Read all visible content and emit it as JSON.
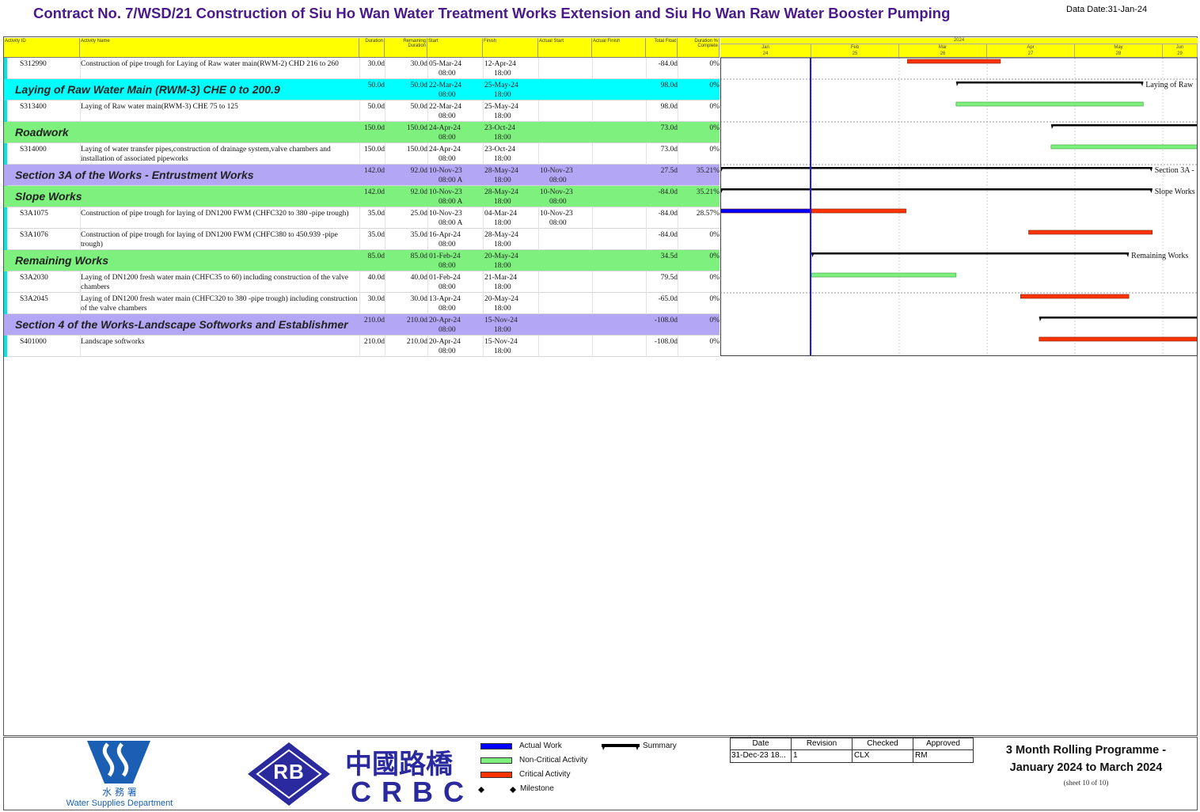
{
  "title": "Contract No. 7/WSD/21 Construction of Siu Ho Wan Water Treatment Works Extension and Siu Ho Wan Raw Water Booster Pumping",
  "data_date": "Data Date:31-Jan-24",
  "columns": {
    "activity_id": "Activity ID",
    "activity_name": "Activity Name",
    "duration": "Duration",
    "remaining_duration": "Remaining Duration",
    "start": "Start",
    "finish": "Finish",
    "actual_start": "Actual Start",
    "actual_finish": "Actual Finish",
    "total_float": "Total Float",
    "duration_pct": "Duration % Complete"
  },
  "timescale": {
    "year": "2024",
    "months": [
      "Jan",
      "Feb",
      "Mar",
      "Apr",
      "May",
      "Jun"
    ],
    "days": [
      "24",
      "25",
      "26",
      "27",
      "28",
      "29"
    ]
  },
  "rows": [
    {
      "type": "activity",
      "id": "S312990",
      "name": "Construction of pipe trough for Laying of Raw water main(RWM-2) CHD 216 to 260",
      "dur": "30.0d",
      "rem": "30.0d",
      "start": "05-Mar-24",
      "start_t": "08:00",
      "finish": "12-Apr-24",
      "finish_t": "18:00",
      "astart": "",
      "astart_t": "",
      "tf": "-84.0d",
      "pct": "0%"
    },
    {
      "type": "group",
      "color": "#00ffff",
      "name": "Laying of Raw Water Main (RWM-3) CHE 0  to 200.9",
      "dur": "50.0d",
      "rem": "50.0d",
      "start": "22-Mar-24",
      "start_t": "08:00",
      "finish": "25-May-24",
      "finish_t": "18:00",
      "astart": "",
      "astart_t": "",
      "tf": "98.0d",
      "pct": "0%",
      "label": "Laying of Raw"
    },
    {
      "type": "activity",
      "id": "S313400",
      "name": "Laying of Raw water main(RWM-3) CHE 75 to 125",
      "dur": "50.0d",
      "rem": "50.0d",
      "start": "22-Mar-24",
      "start_t": "08:00",
      "finish": "25-May-24",
      "finish_t": "18:00",
      "astart": "",
      "astart_t": "",
      "tf": "98.0d",
      "pct": "0%"
    },
    {
      "type": "group",
      "color": "#7df07d",
      "name": "Roadwork",
      "dur": "150.0d",
      "rem": "150.0d",
      "start": "24-Apr-24",
      "start_t": "08:00",
      "finish": "23-Oct-24",
      "finish_t": "18:00",
      "astart": "",
      "astart_t": "",
      "tf": "73.0d",
      "pct": "0%",
      "label": ""
    },
    {
      "type": "activity",
      "id": "S314000",
      "name": "Laying of water transfer pipes,construction of drainage system,valve chambers and installation of associated pipeworks",
      "dur": "150.0d",
      "rem": "150.0d",
      "start": "24-Apr-24",
      "start_t": "08:00",
      "finish": "23-Oct-24",
      "finish_t": "18:00",
      "astart": "",
      "astart_t": "",
      "tf": "73.0d",
      "pct": "0%"
    },
    {
      "type": "group",
      "color": "#b3a6f5",
      "name": "Section 3A of the Works - Entrustment Works",
      "dur": "142.0d",
      "rem": "92.0d",
      "start": "10-Nov-23",
      "start_t": "08:00 A",
      "finish": "28-May-24",
      "finish_t": "18:00",
      "astart": "10-Nov-23",
      "astart_t": "08:00",
      "tf": "27.5d",
      "pct": "35.21%",
      "label": "Section 3A -"
    },
    {
      "type": "group",
      "color": "#7df07d",
      "name": "Slope Works",
      "dur": "142.0d",
      "rem": "92.0d",
      "start": "10-Nov-23",
      "start_t": "08:00 A",
      "finish": "28-May-24",
      "finish_t": "18:00",
      "astart": "10-Nov-23",
      "astart_t": "08:00",
      "tf": "-84.0d",
      "pct": "35.21%",
      "label": "Slope Works"
    },
    {
      "type": "activity",
      "id": "S3A1075",
      "name": "Construction of pipe trough for laying of DN1200 FWM (CHFC320 to 380 -pipe trough)",
      "dur": "35.0d",
      "rem": "25.0d",
      "start": "10-Nov-23",
      "start_t": "08:00 A",
      "finish": "04-Mar-24",
      "finish_t": "18:00",
      "astart": "10-Nov-23",
      "astart_t": "08:00",
      "tf": "-84.0d",
      "pct": "28.57%"
    },
    {
      "type": "activity",
      "id": "S3A1076",
      "name": "Construction of pipe trough for laying of DN1200 FWM (CHFC380 to 450.939 -pipe trough)",
      "dur": "35.0d",
      "rem": "35.0d",
      "start": "16-Apr-24",
      "start_t": "08:00",
      "finish": "28-May-24",
      "finish_t": "18:00",
      "astart": "",
      "astart_t": "",
      "tf": "-84.0d",
      "pct": "0%"
    },
    {
      "type": "group",
      "color": "#7df07d",
      "name": "Remaining Works",
      "dur": "85.0d",
      "rem": "85.0d",
      "start": "01-Feb-24",
      "start_t": "08:00",
      "finish": "20-May-24",
      "finish_t": "18:00",
      "astart": "",
      "astart_t": "",
      "tf": "34.5d",
      "pct": "0%",
      "label": "Remaining Works"
    },
    {
      "type": "activity",
      "id": "S3A2030",
      "name": "Laying of DN1200 fresh water main (CHFC35 to 60) including construction of the valve chambers",
      "dur": "40.0d",
      "rem": "40.0d",
      "start": "01-Feb-24",
      "start_t": "08:00",
      "finish": "21-Mar-24",
      "finish_t": "18:00",
      "astart": "",
      "astart_t": "",
      "tf": "79.5d",
      "pct": "0%"
    },
    {
      "type": "activity",
      "id": "S3A2045",
      "name": "Laying of DN1200 fresh water main (CHFC320 to 380 -pipe trough) including construction of the valve chambers",
      "dur": "30.0d",
      "rem": "30.0d",
      "start": "13-Apr-24",
      "start_t": "08:00",
      "finish": "20-May-24",
      "finish_t": "18:00",
      "astart": "",
      "astart_t": "",
      "tf": "-65.0d",
      "pct": "0%"
    },
    {
      "type": "group",
      "color": "#b3a6f5",
      "name": "Section 4 of the Works-Landscape Softworks and Establishmer",
      "dur": "210.0d",
      "rem": "210.0d",
      "start": "20-Apr-24",
      "start_t": "08:00",
      "finish": "15-Nov-24",
      "finish_t": "18:00",
      "astart": "",
      "astart_t": "",
      "tf": "-108.0d",
      "pct": "0%",
      "label": ""
    },
    {
      "type": "activity",
      "id": "S401000",
      "name": "Landscape softworks",
      "dur": "210.0d",
      "rem": "210.0d",
      "start": "20-Apr-24",
      "start_t": "08:00",
      "finish": "15-Nov-24",
      "finish_t": "18:00",
      "astart": "",
      "astart_t": "",
      "tf": "-108.0d",
      "pct": "0%"
    }
  ],
  "bars": [
    {
      "row": 0,
      "kind": "critical",
      "from": 0.392,
      "to": 0.587
    },
    {
      "row": 1,
      "kind": "summary",
      "from": 0.494,
      "to": 0.886
    },
    {
      "row": 2,
      "kind": "noncritical",
      "from": 0.494,
      "to": 0.886
    },
    {
      "row": 3,
      "kind": "summary",
      "from": 0.693,
      "to": 1.0
    },
    {
      "row": 4,
      "kind": "noncritical",
      "from": 0.693,
      "to": 1.0
    },
    {
      "row": 5,
      "kind": "summary",
      "from": 0.0,
      "to": 0.905
    },
    {
      "row": 6,
      "kind": "summary",
      "from": 0.0,
      "to": 0.905
    },
    {
      "row": 7,
      "kind": "actual",
      "from": 0.0,
      "to": 0.191
    },
    {
      "row": 7,
      "kind": "critical",
      "from": 0.191,
      "to": 0.389
    },
    {
      "row": 8,
      "kind": "critical",
      "from": 0.646,
      "to": 0.905
    },
    {
      "row": 9,
      "kind": "summary",
      "from": 0.191,
      "to": 0.856
    },
    {
      "row": 10,
      "kind": "noncritical",
      "from": 0.191,
      "to": 0.494
    },
    {
      "row": 11,
      "kind": "critical",
      "from": 0.629,
      "to": 0.856
    },
    {
      "row": 12,
      "kind": "summary",
      "from": 0.668,
      "to": 1.0
    },
    {
      "row": 13,
      "kind": "critical",
      "from": 0.668,
      "to": 1.0
    }
  ],
  "colors": {
    "actual": "#0000ff",
    "noncritical": "#7df07d",
    "critical": "#ff3300",
    "summary": "#000000",
    "data_date_line": "#1a1aff"
  },
  "footer": {
    "wsd_name_cn": "水 務 署",
    "wsd_name_en": "Water Supplies Department",
    "crbc_logo_text": "RB",
    "crbc_cn": "中國路橋",
    "crbc_en": "CRBC",
    "legend": {
      "actual": "Actual Work",
      "noncritical": "Non-Critical Activity",
      "critical": "Critical Activity",
      "milestone": "Milestone",
      "summary": "Summary"
    },
    "revision_table": {
      "headers": [
        "Date",
        "Revision",
        "Checked",
        "Approved"
      ],
      "values": [
        "31-Dec-23 18...",
        "1",
        "CLX",
        "RM"
      ]
    },
    "programme_title_1": "3 Month Rolling Programme -",
    "programme_title_2": "January 2024 to March 2024",
    "sheet": "(sheet 10 of 10)"
  }
}
